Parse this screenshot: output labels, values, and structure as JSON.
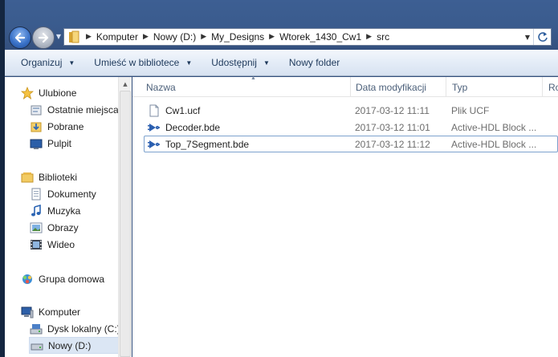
{
  "window": {
    "frame_color": "#3a5b8d",
    "selection_color": "#dbe6f4"
  },
  "address_bar": {
    "breadcrumbs": [
      {
        "label": "Komputer"
      },
      {
        "label": "Nowy (D:)"
      },
      {
        "label": "My_Designs"
      },
      {
        "label": "Wtorek_1430_Cw1"
      },
      {
        "label": "src"
      }
    ],
    "icons": {
      "back": "back-arrow-icon",
      "forward": "forward-arrow-icon",
      "folder": "folder-icon",
      "refresh": "refresh-icon"
    }
  },
  "toolbar": {
    "organize": "Organizuj",
    "include_in_library": "Umieść w bibliotece",
    "share": "Udostępnij",
    "new_folder": "Nowy folder"
  },
  "nav": {
    "favorites": {
      "label": "Ulubione",
      "icon": "star-icon",
      "items": [
        {
          "label": "Ostatnie miejsca",
          "icon": "recent-places-icon"
        },
        {
          "label": "Pobrane",
          "icon": "downloads-icon"
        },
        {
          "label": "Pulpit",
          "icon": "desktop-icon"
        }
      ]
    },
    "libraries": {
      "label": "Biblioteki",
      "icon": "library-icon",
      "items": [
        {
          "label": "Dokumenty",
          "icon": "documents-icon"
        },
        {
          "label": "Muzyka",
          "icon": "music-icon"
        },
        {
          "label": "Obrazy",
          "icon": "pictures-icon"
        },
        {
          "label": "Wideo",
          "icon": "video-icon"
        }
      ]
    },
    "homegroup": {
      "label": "Grupa domowa",
      "icon": "homegroup-icon"
    },
    "computer": {
      "label": "Komputer",
      "icon": "computer-icon",
      "items": [
        {
          "label": "Dysk lokalny (C:)",
          "icon": "local-disk-icon"
        },
        {
          "label": "Nowy (D:)",
          "icon": "drive-icon"
        }
      ]
    }
  },
  "columns": {
    "name": "Nazwa",
    "date": "Data modyfikacji",
    "type": "Typ",
    "size": "Ro"
  },
  "files": [
    {
      "name": "Cw1.ucf",
      "date": "2017-03-12 11:11",
      "type": "Plik UCF",
      "icon": "ucf-file-icon"
    },
    {
      "name": "Decoder.bde",
      "date": "2017-03-12 11:01",
      "type": "Active-HDL Block ...",
      "icon": "bde-block-icon"
    },
    {
      "name": "Top_7Segment.bde",
      "date": "2017-03-12 11:12",
      "type": "Active-HDL Block ...",
      "icon": "bde-block-icon"
    }
  ]
}
